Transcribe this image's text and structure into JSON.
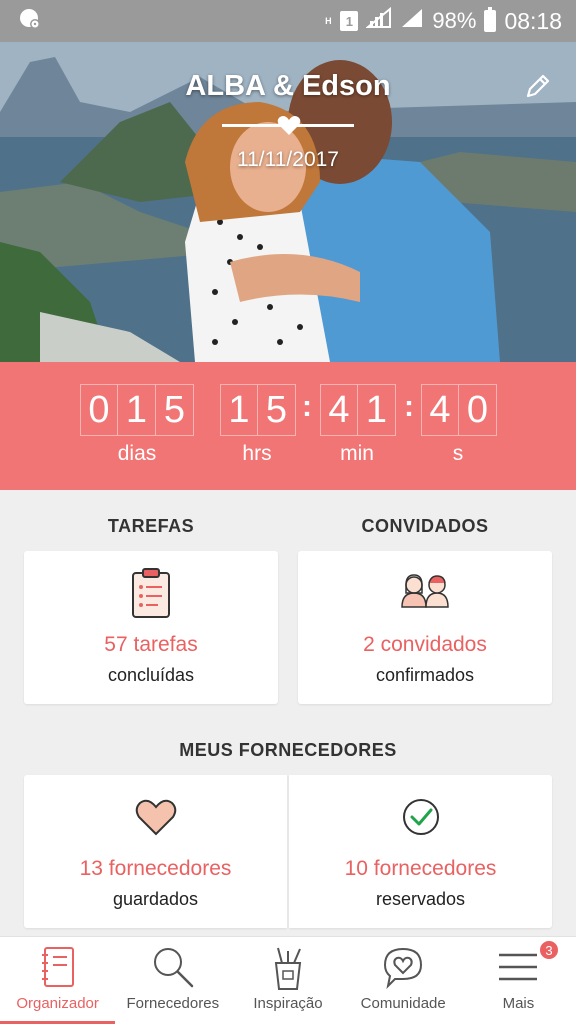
{
  "status_bar": {
    "network_type": "H",
    "sim_slot": "1",
    "battery_percent": "98%",
    "time": "08:18"
  },
  "hero": {
    "couple_names": "ALBA & Edson",
    "wedding_date": "11/11/2017"
  },
  "countdown": {
    "days": [
      "0",
      "1",
      "5"
    ],
    "hours": [
      "1",
      "5"
    ],
    "minutes": [
      "4",
      "1"
    ],
    "seconds": [
      "4",
      "0"
    ],
    "separator": ":",
    "labels": {
      "days": "dias",
      "hours": "hrs",
      "minutes": "min",
      "seconds": "s"
    }
  },
  "tasks": {
    "title": "TAREFAS",
    "count_label": "57 tarefas",
    "sub_label": "concluídas"
  },
  "guests": {
    "title": "CONVIDADOS",
    "count_label": "2 convidados",
    "sub_label": "confirmados"
  },
  "suppliers": {
    "title": "MEUS FORNECEDORES",
    "saved": {
      "count_label": "13 fornecedores",
      "sub_label": "guardados"
    },
    "booked": {
      "count_label": "10 fornecedores",
      "sub_label": "reservados"
    }
  },
  "bottom_nav": {
    "items": [
      {
        "label": "Organizador",
        "icon": "notebook-icon",
        "active": true
      },
      {
        "label": "Fornecedores",
        "icon": "search-icon",
        "active": false
      },
      {
        "label": "Inspiração",
        "icon": "pencil-cup-icon",
        "active": false
      },
      {
        "label": "Comunidade",
        "icon": "heart-chat-icon",
        "active": false
      },
      {
        "label": "Mais",
        "icon": "menu-icon",
        "active": false,
        "badge": "3"
      }
    ]
  },
  "colors": {
    "accent": "#f27575",
    "accent_text": "#ea6161",
    "background": "#efefef",
    "status_bar": "#9a9a9a"
  }
}
